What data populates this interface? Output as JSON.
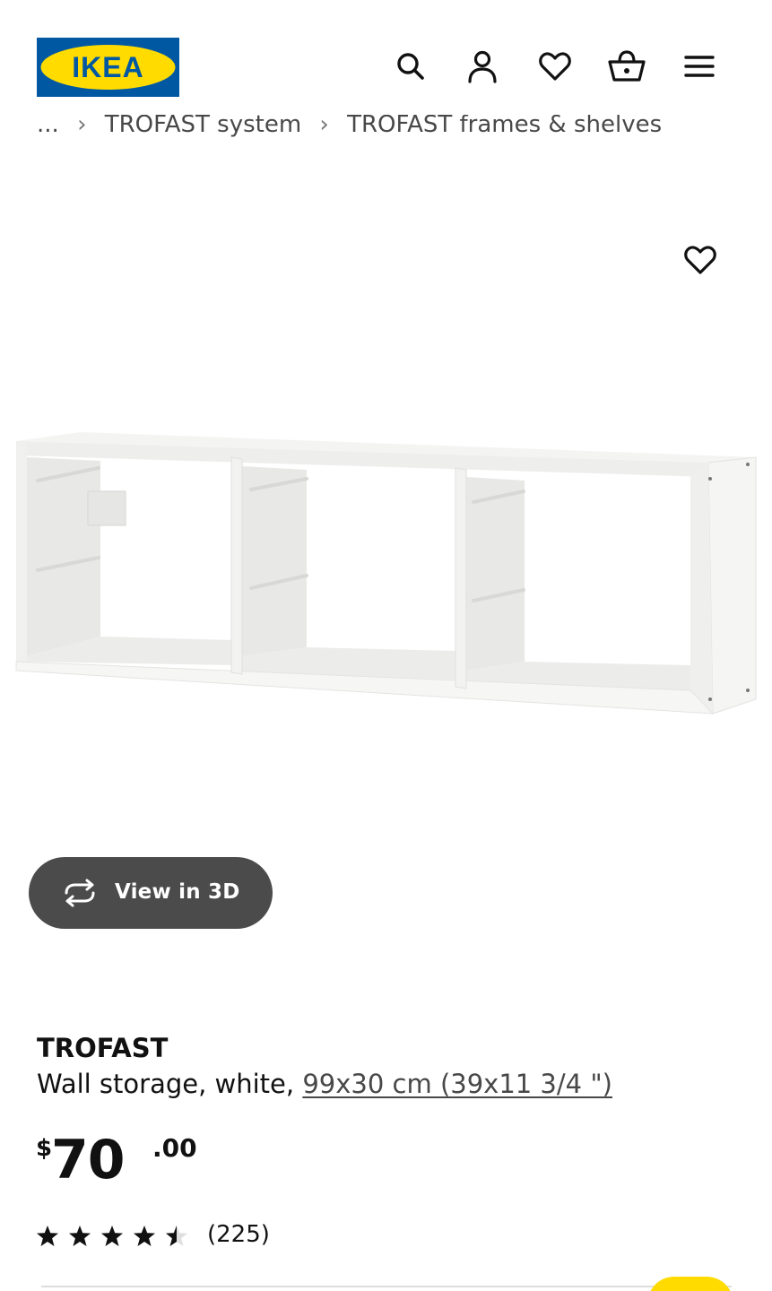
{
  "brand": {
    "logo_text": "IKEA",
    "colors": {
      "blue": "#0058a3",
      "yellow": "#ffdb00"
    }
  },
  "header": {
    "icons": [
      "search-icon",
      "user-icon",
      "heart-icon",
      "cart-icon",
      "menu-icon"
    ]
  },
  "breadcrumb": {
    "items": [
      "...",
      "TROFAST system",
      "TROFAST frames & shelves"
    ]
  },
  "product": {
    "favorite_icon": "heart-icon",
    "view3d_label": "View in 3D",
    "name": "TROFAST",
    "description_prefix": "Wall storage, white,",
    "size_link": "99x30 cm (39x11 3/4 \")",
    "price": {
      "currency": "$",
      "integer": "70",
      "decimal": ".00"
    },
    "rating": {
      "value": 4.5,
      "max": 5,
      "count_text": "(225)"
    }
  }
}
